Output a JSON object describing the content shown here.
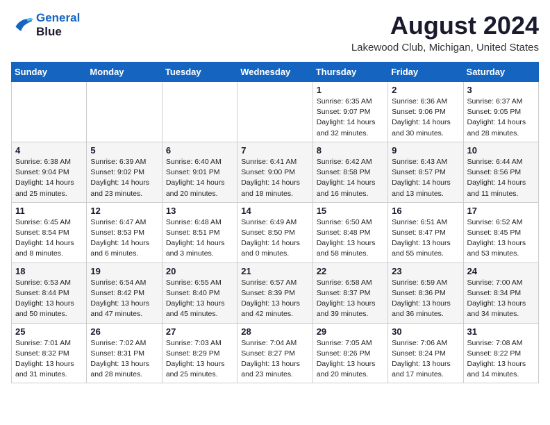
{
  "header": {
    "logo_line1": "General",
    "logo_line2": "Blue",
    "month_title": "August 2024",
    "location": "Lakewood Club, Michigan, United States"
  },
  "weekdays": [
    "Sunday",
    "Monday",
    "Tuesday",
    "Wednesday",
    "Thursday",
    "Friday",
    "Saturday"
  ],
  "weeks": [
    [
      {
        "day": "",
        "info": ""
      },
      {
        "day": "",
        "info": ""
      },
      {
        "day": "",
        "info": ""
      },
      {
        "day": "",
        "info": ""
      },
      {
        "day": "1",
        "info": "Sunrise: 6:35 AM\nSunset: 9:07 PM\nDaylight: 14 hours\nand 32 minutes."
      },
      {
        "day": "2",
        "info": "Sunrise: 6:36 AM\nSunset: 9:06 PM\nDaylight: 14 hours\nand 30 minutes."
      },
      {
        "day": "3",
        "info": "Sunrise: 6:37 AM\nSunset: 9:05 PM\nDaylight: 14 hours\nand 28 minutes."
      }
    ],
    [
      {
        "day": "4",
        "info": "Sunrise: 6:38 AM\nSunset: 9:04 PM\nDaylight: 14 hours\nand 25 minutes."
      },
      {
        "day": "5",
        "info": "Sunrise: 6:39 AM\nSunset: 9:02 PM\nDaylight: 14 hours\nand 23 minutes."
      },
      {
        "day": "6",
        "info": "Sunrise: 6:40 AM\nSunset: 9:01 PM\nDaylight: 14 hours\nand 20 minutes."
      },
      {
        "day": "7",
        "info": "Sunrise: 6:41 AM\nSunset: 9:00 PM\nDaylight: 14 hours\nand 18 minutes."
      },
      {
        "day": "8",
        "info": "Sunrise: 6:42 AM\nSunset: 8:58 PM\nDaylight: 14 hours\nand 16 minutes."
      },
      {
        "day": "9",
        "info": "Sunrise: 6:43 AM\nSunset: 8:57 PM\nDaylight: 14 hours\nand 13 minutes."
      },
      {
        "day": "10",
        "info": "Sunrise: 6:44 AM\nSunset: 8:56 PM\nDaylight: 14 hours\nand 11 minutes."
      }
    ],
    [
      {
        "day": "11",
        "info": "Sunrise: 6:45 AM\nSunset: 8:54 PM\nDaylight: 14 hours\nand 8 minutes."
      },
      {
        "day": "12",
        "info": "Sunrise: 6:47 AM\nSunset: 8:53 PM\nDaylight: 14 hours\nand 6 minutes."
      },
      {
        "day": "13",
        "info": "Sunrise: 6:48 AM\nSunset: 8:51 PM\nDaylight: 14 hours\nand 3 minutes."
      },
      {
        "day": "14",
        "info": "Sunrise: 6:49 AM\nSunset: 8:50 PM\nDaylight: 14 hours\nand 0 minutes."
      },
      {
        "day": "15",
        "info": "Sunrise: 6:50 AM\nSunset: 8:48 PM\nDaylight: 13 hours\nand 58 minutes."
      },
      {
        "day": "16",
        "info": "Sunrise: 6:51 AM\nSunset: 8:47 PM\nDaylight: 13 hours\nand 55 minutes."
      },
      {
        "day": "17",
        "info": "Sunrise: 6:52 AM\nSunset: 8:45 PM\nDaylight: 13 hours\nand 53 minutes."
      }
    ],
    [
      {
        "day": "18",
        "info": "Sunrise: 6:53 AM\nSunset: 8:44 PM\nDaylight: 13 hours\nand 50 minutes."
      },
      {
        "day": "19",
        "info": "Sunrise: 6:54 AM\nSunset: 8:42 PM\nDaylight: 13 hours\nand 47 minutes."
      },
      {
        "day": "20",
        "info": "Sunrise: 6:55 AM\nSunset: 8:40 PM\nDaylight: 13 hours\nand 45 minutes."
      },
      {
        "day": "21",
        "info": "Sunrise: 6:57 AM\nSunset: 8:39 PM\nDaylight: 13 hours\nand 42 minutes."
      },
      {
        "day": "22",
        "info": "Sunrise: 6:58 AM\nSunset: 8:37 PM\nDaylight: 13 hours\nand 39 minutes."
      },
      {
        "day": "23",
        "info": "Sunrise: 6:59 AM\nSunset: 8:36 PM\nDaylight: 13 hours\nand 36 minutes."
      },
      {
        "day": "24",
        "info": "Sunrise: 7:00 AM\nSunset: 8:34 PM\nDaylight: 13 hours\nand 34 minutes."
      }
    ],
    [
      {
        "day": "25",
        "info": "Sunrise: 7:01 AM\nSunset: 8:32 PM\nDaylight: 13 hours\nand 31 minutes."
      },
      {
        "day": "26",
        "info": "Sunrise: 7:02 AM\nSunset: 8:31 PM\nDaylight: 13 hours\nand 28 minutes."
      },
      {
        "day": "27",
        "info": "Sunrise: 7:03 AM\nSunset: 8:29 PM\nDaylight: 13 hours\nand 25 minutes."
      },
      {
        "day": "28",
        "info": "Sunrise: 7:04 AM\nSunset: 8:27 PM\nDaylight: 13 hours\nand 23 minutes."
      },
      {
        "day": "29",
        "info": "Sunrise: 7:05 AM\nSunset: 8:26 PM\nDaylight: 13 hours\nand 20 minutes."
      },
      {
        "day": "30",
        "info": "Sunrise: 7:06 AM\nSunset: 8:24 PM\nDaylight: 13 hours\nand 17 minutes."
      },
      {
        "day": "31",
        "info": "Sunrise: 7:08 AM\nSunset: 8:22 PM\nDaylight: 13 hours\nand 14 minutes."
      }
    ]
  ]
}
